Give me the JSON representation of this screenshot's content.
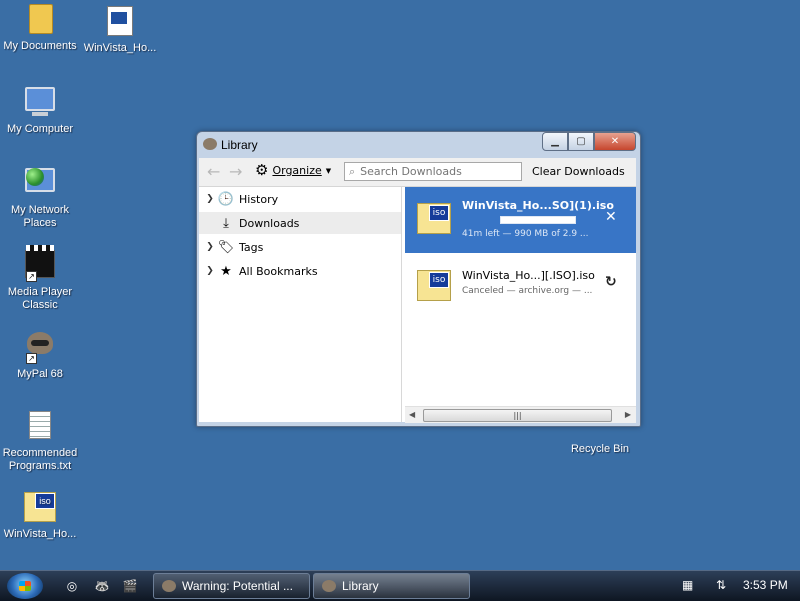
{
  "desktop": {
    "icons": [
      {
        "label": "My Documents"
      },
      {
        "label": "WinVista_Ho..."
      },
      {
        "label": "My Computer"
      },
      {
        "label": "My Network Places"
      },
      {
        "label": "Media Player Classic"
      },
      {
        "label": "MyPal 68"
      },
      {
        "label": "Recommended Programs.txt"
      },
      {
        "label": "WinVista_Ho..."
      },
      {
        "label": "Recycle Bin"
      }
    ]
  },
  "window": {
    "title": "Library",
    "toolbar": {
      "organize_label": "Organize",
      "search_placeholder": "Search Downloads",
      "clear_label": "Clear Downloads"
    },
    "sidebar": {
      "items": [
        {
          "label": "History"
        },
        {
          "label": "Downloads"
        },
        {
          "label": "Tags"
        },
        {
          "label": "All Bookmarks"
        }
      ]
    },
    "downloads": [
      {
        "icon_text": "iso",
        "name": "WinVista_Ho...SO](1).iso",
        "status": "41m left — 990 MB of 2.9 ...",
        "progress": 1.0
      },
      {
        "icon_text": "iso",
        "name": "WinVista_Ho...][.ISO].iso",
        "status": "Canceled — archive.org — ..."
      }
    ]
  },
  "taskbar": {
    "tasks": [
      {
        "label": "Warning: Potential ..."
      },
      {
        "label": "Library"
      }
    ],
    "clock": "3:53 PM"
  },
  "colors": {
    "desktop": "#3a6ea5",
    "selection": "#3875c6"
  }
}
